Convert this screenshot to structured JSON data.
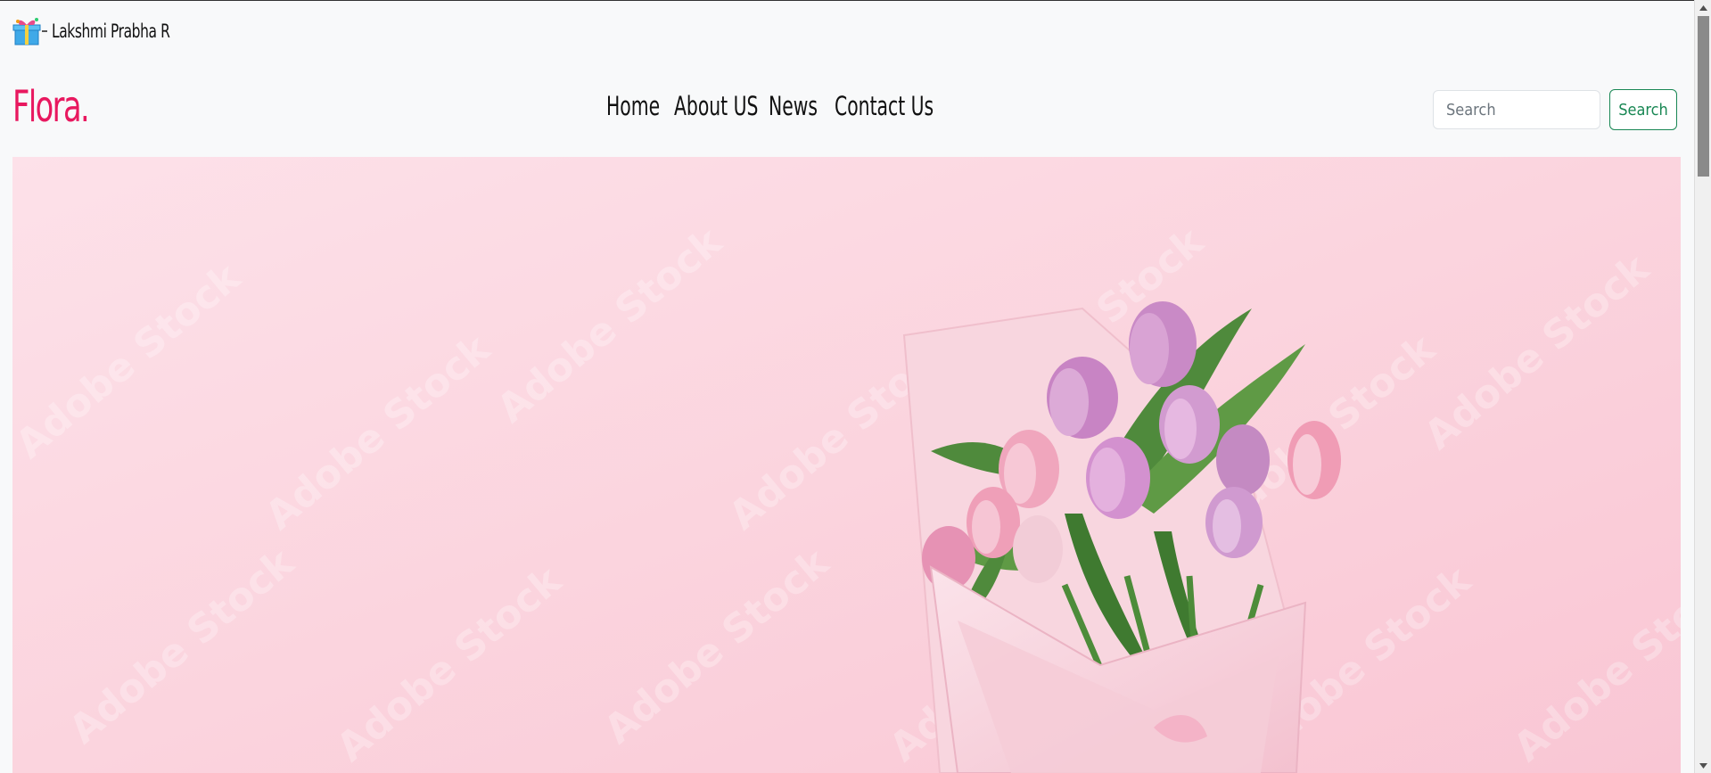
{
  "brand": {
    "name": "Lakshmi Prabha R"
  },
  "navbar": {
    "logo": "Flora.",
    "links": [
      "Home",
      "About US",
      "News",
      "Contact Us"
    ],
    "search_placeholder": "Search",
    "search_button": "Search"
  },
  "hero": {
    "image": "pink tulip bouquet wrapped in paper on pink background",
    "watermark": "Adobe Stock"
  },
  "colors": {
    "logo": "#e8185f",
    "search_button": "#198754",
    "navbar_bg": "#f8f9fa",
    "hero_bg": "#fbd3de"
  }
}
